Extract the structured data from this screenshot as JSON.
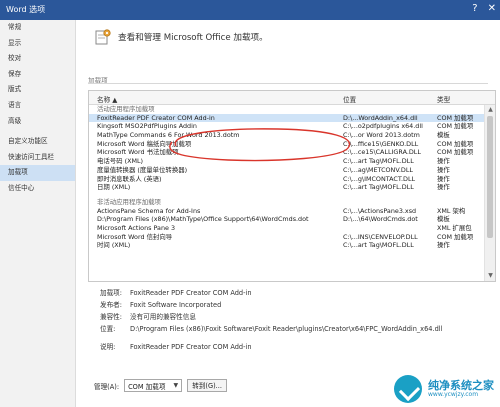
{
  "window": {
    "title": "Word 选项",
    "help_glyph": "?",
    "close_glyph": "✕"
  },
  "sidebar": {
    "items": [
      {
        "label": "常规"
      },
      {
        "label": "显示"
      },
      {
        "label": "校对"
      },
      {
        "label": "保存"
      },
      {
        "label": "版式"
      },
      {
        "label": "语言"
      },
      {
        "label": "高级"
      },
      {
        "label": "自定义功能区"
      },
      {
        "label": "快速访问工具栏"
      },
      {
        "label": "加载项",
        "selected": true
      },
      {
        "label": "信任中心"
      }
    ]
  },
  "main": {
    "heading": "查看和管理 Microsoft Office 加载项。",
    "section_label": "加载项",
    "columns": {
      "name": "名称 ▲",
      "location": "位置",
      "type": "类型"
    },
    "rows": [
      {
        "kind": "group",
        "name": "活动应用程序加载项"
      },
      {
        "name": "FoxitReader PDF Creator COM Add-in",
        "location": "D:\\...WordAddin_x64.dll",
        "type": "COM 加载项",
        "selected": true
      },
      {
        "name": "Kingsoft MSO2PdfPlugins Addin",
        "location": "C:\\...o2pdfplugins x64.dll",
        "type": "COM 加载项"
      },
      {
        "name": "MathType Commands 6 For Word 2013.dotm",
        "location": "C:\\...or Word 2013.dotm",
        "type": "模板"
      },
      {
        "name": "Microsoft Word 稿纸向导加载项",
        "location": "C:\\...ffice15\\GENKO.DLL",
        "type": "COM 加载项"
      },
      {
        "name": "Microsoft Word 书法加载项",
        "location": "C:\\...ce15\\CALLIGRA.DLL",
        "type": "COM 加载项"
      },
      {
        "name": "电话号码 (XML)",
        "location": "C:\\...art Tag\\MOFL.DLL",
        "type": "操作"
      },
      {
        "name": "度量值转换器 (度量单位转换器)",
        "location": "C:\\...ag\\METCONV.DLL",
        "type": "操作"
      },
      {
        "name": "即时消息联系人 (英语)",
        "location": "C:\\...g\\IMCONTACT.DLL",
        "type": "操作"
      },
      {
        "name": "日期 (XML)",
        "location": "C:\\...art Tag\\MOFL.DLL",
        "type": "操作"
      },
      {
        "kind": "gap"
      },
      {
        "kind": "group",
        "name": "非活动应用程序加载项"
      },
      {
        "name": "ActionsPane Schema for Add-Ins",
        "location": "C:\\...\\ActionsPane3.xsd",
        "type": "XML 架构"
      },
      {
        "name": "D:\\Program Files (x86)\\MathType\\Office Support\\64\\WordCmds.dot",
        "location": "D:\\...\\64\\WordCmds.dot",
        "type": "模板"
      },
      {
        "name": "Microsoft Actions Pane 3",
        "location": "",
        "type": "XML 扩展包"
      },
      {
        "name": "Microsoft Word 信封向导",
        "location": "C:\\...INS\\CENVELOP.DLL",
        "type": "COM 加载项"
      },
      {
        "name": "时间 (XML)",
        "location": "C:\\...art Tag\\MOFL.DLL",
        "type": "操作"
      }
    ],
    "details": {
      "addin_label": "加载项:",
      "addin_value": "FoxitReader PDF Creator COM Add-in",
      "publisher_label": "发布者:",
      "publisher_value": "Foxit Software Incorporated",
      "compat_label": "兼容性:",
      "compat_value": "没有可用的兼容性信息",
      "location_label": "位置:",
      "location_value": "D:\\Program Files (x86)\\Foxit Software\\Foxit Reader\\plugins\\Creator\\x64\\FPC_WordAddin_x64.dll",
      "desc_label": "说明:",
      "desc_value": "FoxitReader PDF Creator COM Add-in"
    },
    "manage": {
      "label": "管理(A):",
      "selected": "COM 加载项",
      "go_label": "转到(G)..."
    }
  },
  "watermark": {
    "title": "纯净系统之家",
    "url": "www.ycwjzy.com"
  },
  "colors": {
    "titlebar": "#2b579a",
    "selection": "#cfe3f7",
    "annotation": "#d9352b"
  }
}
